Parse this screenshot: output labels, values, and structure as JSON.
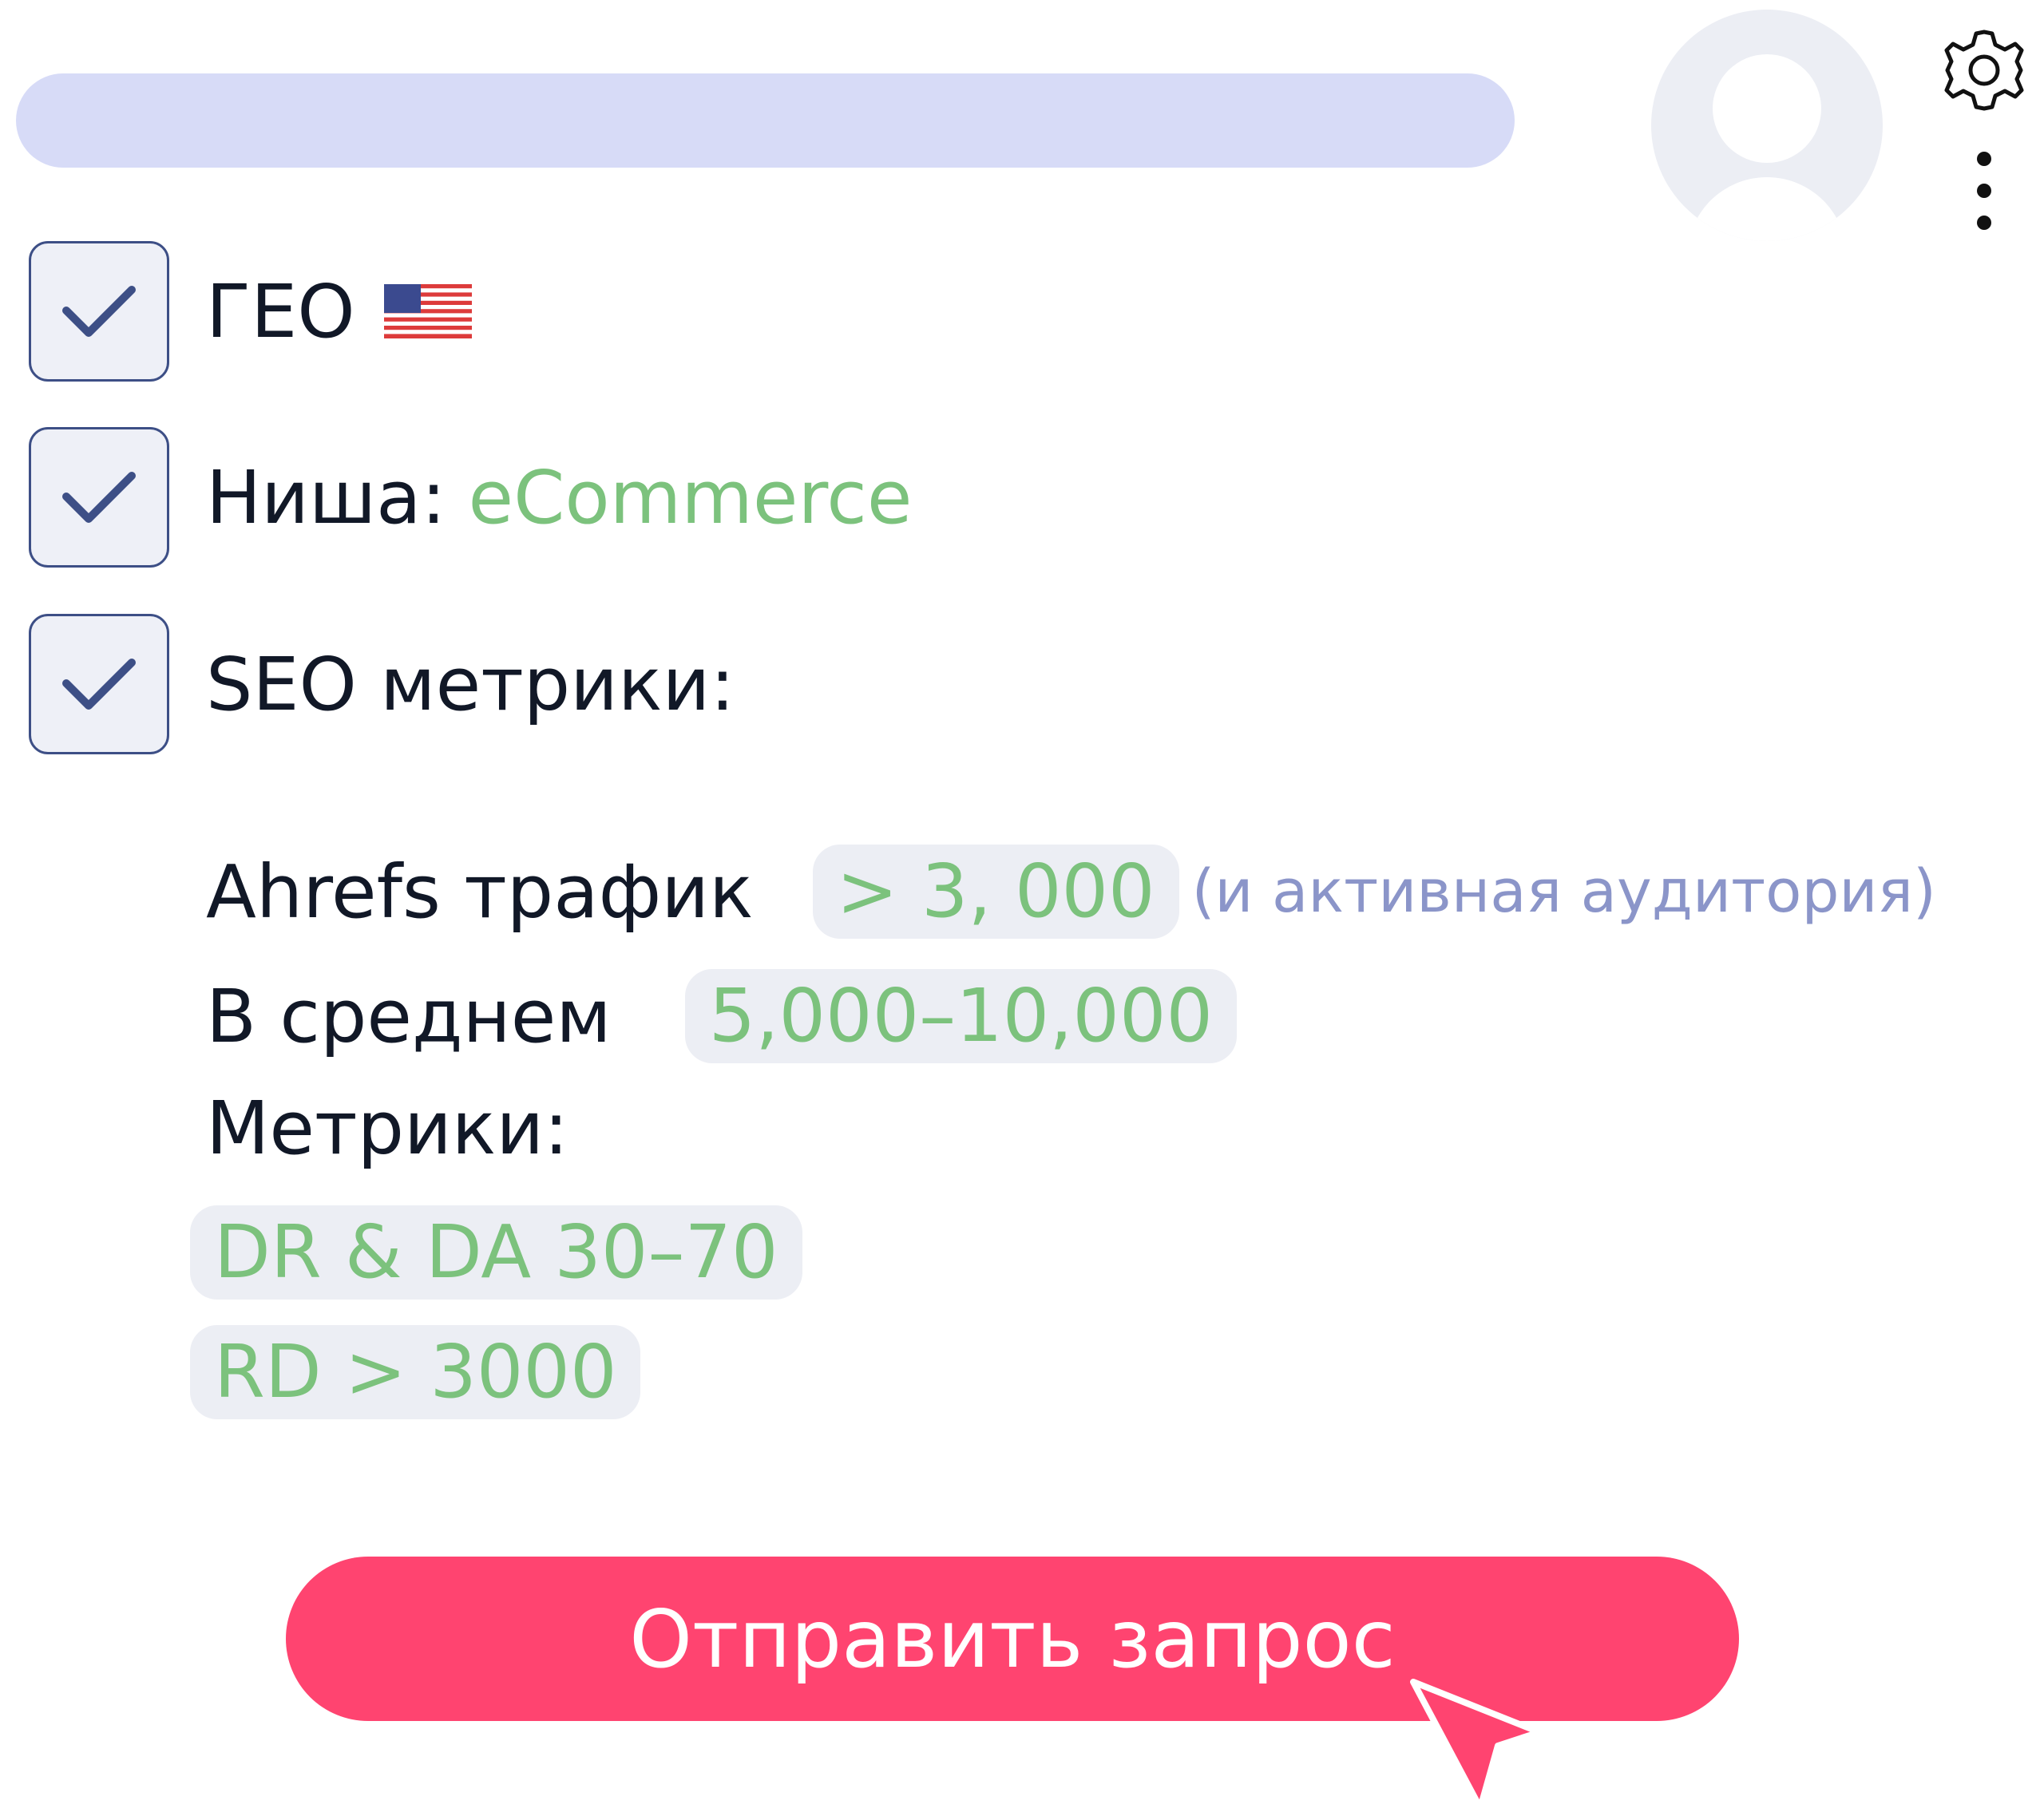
{
  "header": {
    "search_bar_color": "#d7dbf7",
    "avatar_icon": "user-avatar-icon",
    "settings_icon": "gear-icon",
    "more_icon": "more-vertical-icon"
  },
  "checklist": [
    {
      "label": "ГЕО",
      "checked": true,
      "icon": "us-flag-icon"
    },
    {
      "label": "Ниша:",
      "value": "eCommerce",
      "checked": true
    },
    {
      "label": "SEO метрики:",
      "checked": true
    }
  ],
  "metrics": {
    "ahrefs_label": "Ahrefs трафик",
    "ahrefs_value": "> 3, 000",
    "ahrefs_note": "(и активная аудитория)",
    "average_label": "В среднем",
    "average_value": "5,000–10,000",
    "metrics_label": "Метрики:",
    "dr_da": "DR & DA 30–70",
    "rd": "RD > 3000"
  },
  "colors": {
    "accent_green": "#7cc27d",
    "note_blue": "#8b95c9",
    "button_pink": "#ff4470",
    "checkbox_border": "#3d4f86"
  },
  "submit": {
    "label": "Отправить запрос"
  }
}
